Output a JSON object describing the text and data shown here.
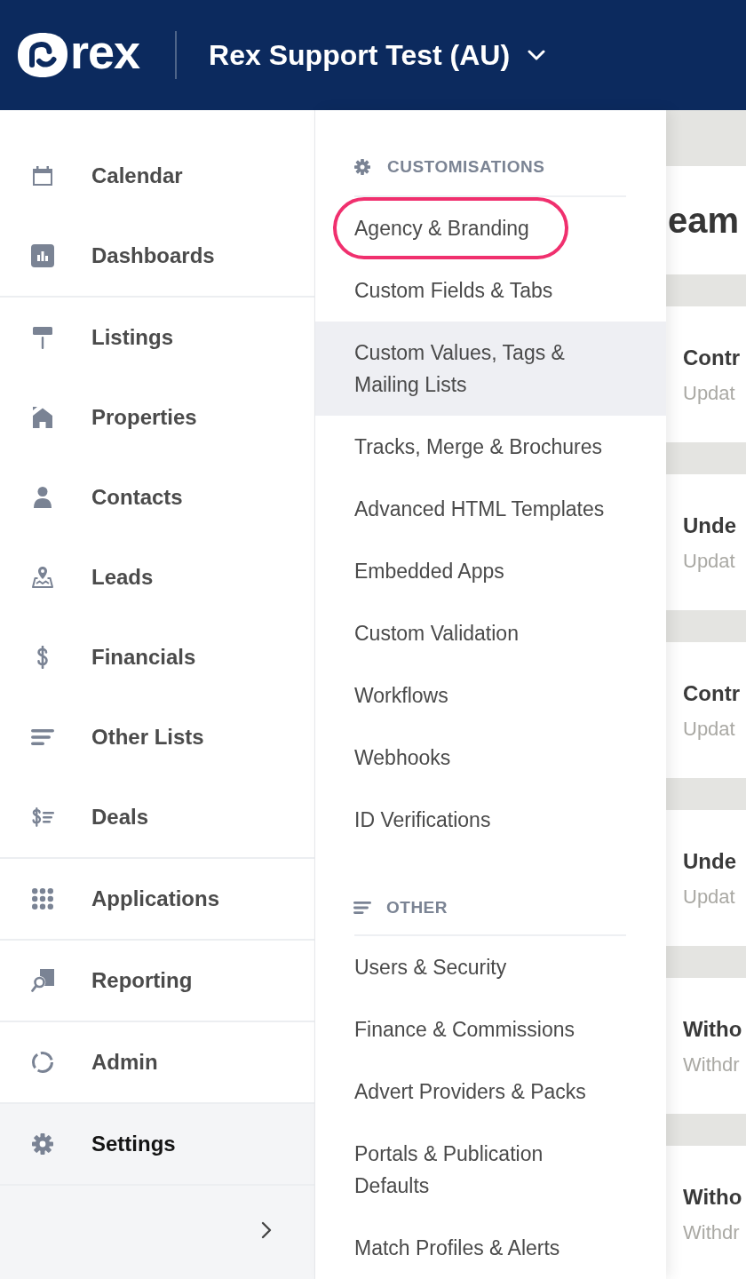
{
  "header": {
    "logo_text": "rex",
    "account_name": "Rex Support Test (AU)"
  },
  "sidebar": {
    "groups": [
      {
        "items": [
          {
            "label": "Calendar",
            "selected": false
          },
          {
            "label": "Dashboards",
            "selected": false
          }
        ]
      },
      {
        "items": [
          {
            "label": "Listings",
            "selected": false
          },
          {
            "label": "Properties",
            "selected": false
          },
          {
            "label": "Contacts",
            "selected": false
          },
          {
            "label": "Leads",
            "selected": false
          },
          {
            "label": "Financials",
            "selected": false
          },
          {
            "label": "Other Lists",
            "selected": false
          },
          {
            "label": "Deals",
            "selected": false
          }
        ]
      },
      {
        "items": [
          {
            "label": "Applications",
            "selected": false
          }
        ]
      },
      {
        "items": [
          {
            "label": "Reporting",
            "selected": false
          }
        ]
      },
      {
        "items": [
          {
            "label": "Admin",
            "selected": false
          }
        ]
      },
      {
        "items": [
          {
            "label": "Settings",
            "selected": true
          }
        ]
      }
    ]
  },
  "settings_menu": {
    "sections": [
      {
        "title": "CUSTOMISATIONS",
        "items": [
          {
            "label": "Agency & Branding",
            "highlighted": true,
            "hovered": false
          },
          {
            "label": "Custom Fields & Tabs",
            "highlighted": false,
            "hovered": false
          },
          {
            "label": "Custom Values, Tags & Mailing Lists",
            "highlighted": false,
            "hovered": true
          },
          {
            "label": "Tracks, Merge & Brochures",
            "highlighted": false,
            "hovered": false
          },
          {
            "label": "Advanced HTML Templates",
            "highlighted": false,
            "hovered": false
          },
          {
            "label": "Embedded Apps",
            "highlighted": false,
            "hovered": false
          },
          {
            "label": "Custom Validation",
            "highlighted": false,
            "hovered": false
          },
          {
            "label": "Workflows",
            "highlighted": false,
            "hovered": false
          },
          {
            "label": "Webhooks",
            "highlighted": false,
            "hovered": false
          },
          {
            "label": "ID Verifications",
            "highlighted": false,
            "hovered": false
          }
        ]
      },
      {
        "title": "OTHER",
        "items": [
          {
            "label": "Users & Security",
            "highlighted": false,
            "hovered": false
          },
          {
            "label": "Finance & Commissions",
            "highlighted": false,
            "hovered": false
          },
          {
            "label": "Advert Providers & Packs",
            "highlighted": false,
            "hovered": false
          },
          {
            "label": "Portals & Publication Defaults",
            "highlighted": false,
            "hovered": false
          },
          {
            "label": "Match Profiles & Alerts",
            "highlighted": false,
            "hovered": false
          }
        ]
      }
    ]
  },
  "content": {
    "title": "eam",
    "cards": [
      {
        "title": "Contr",
        "subtitle": "Updat"
      },
      {
        "title": "Unde",
        "subtitle": "Updat"
      },
      {
        "title": "Contr",
        "subtitle": "Updat"
      },
      {
        "title": "Unde",
        "subtitle": "Updat"
      },
      {
        "title": "Witho",
        "subtitle": "Withdr"
      },
      {
        "title": "Witho",
        "subtitle": "Withdr"
      }
    ]
  }
}
